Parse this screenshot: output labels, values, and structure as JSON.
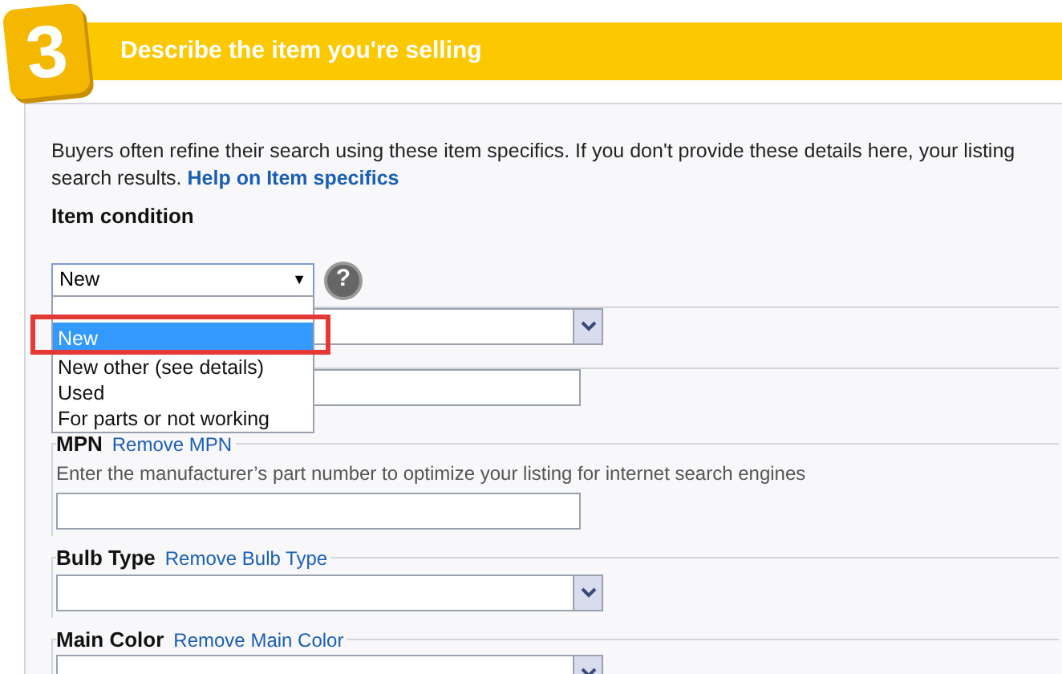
{
  "header": {
    "step": "3",
    "title": "Describe the item you're selling"
  },
  "intro": {
    "visible_text": "Buyers often refine their search using these item specifics. If you don't provide these details here, your listing",
    "second_line": "search results.",
    "link": "Help on Item specifics"
  },
  "condition": {
    "label": "Item condition",
    "value": "New",
    "caret": "▼",
    "help": "?",
    "expanded": true,
    "options": [
      {
        "label": "New",
        "selected": true
      },
      {
        "label": "New other (see details)",
        "selected": false
      },
      {
        "label": "Used",
        "selected": false
      },
      {
        "label": "For parts or not working",
        "selected": false
      }
    ]
  },
  "fields": [
    {
      "kind": "select"
    },
    {
      "kind": "input"
    },
    {
      "kind": "input",
      "label": "MPN",
      "remove": "Remove **MPN**",
      "hint": "Enter the manufacturer’s part number to optimize your listing for internet search engines"
    },
    {
      "kind": "select",
      "label": "Bulb Type",
      "remove": "Remove **Bulb Type**"
    },
    {
      "kind": "select",
      "label": "Main Color",
      "remove": "Remove **Main Color**"
    }
  ]
}
